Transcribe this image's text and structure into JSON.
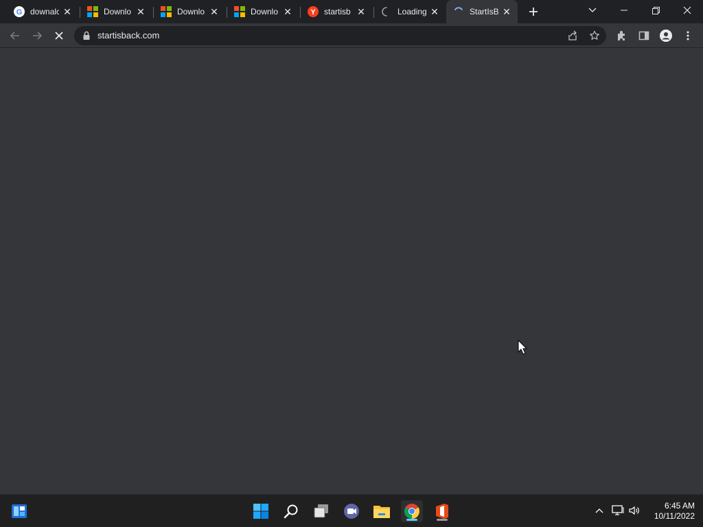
{
  "browser": {
    "tabs": [
      {
        "title": "downalc",
        "favicon": "google-icon",
        "state": "normal"
      },
      {
        "title": "Downlo",
        "favicon": "microsoft-icon",
        "state": "normal"
      },
      {
        "title": "Downlo",
        "favicon": "microsoft-icon",
        "state": "normal"
      },
      {
        "title": "Downlo",
        "favicon": "microsoft-icon",
        "state": "normal"
      },
      {
        "title": "startisb",
        "favicon": "yandex-icon",
        "state": "normal"
      },
      {
        "title": "Loading",
        "favicon": "loading-spinner-icon",
        "state": "loading"
      },
      {
        "title": "StartIsB",
        "favicon": "loading-spinner-icon",
        "state": "active-loading"
      }
    ],
    "address_bar": {
      "url": "startisback.com"
    }
  },
  "taskbar": {
    "pinned": [
      "widgets-icon",
      "start-icon",
      "search-icon",
      "task-view-icon",
      "teams-chat-icon",
      "file-explorer-icon",
      "chrome-icon",
      "office-icon"
    ],
    "clock": {
      "time": "6:45 AM",
      "date": "10/11/2022"
    }
  },
  "colors": {
    "tabstrip": "#202124",
    "toolbar": "#35363a",
    "page_background": "#35363a",
    "taskbar": "#202020",
    "accent": "#8ab4f8"
  }
}
